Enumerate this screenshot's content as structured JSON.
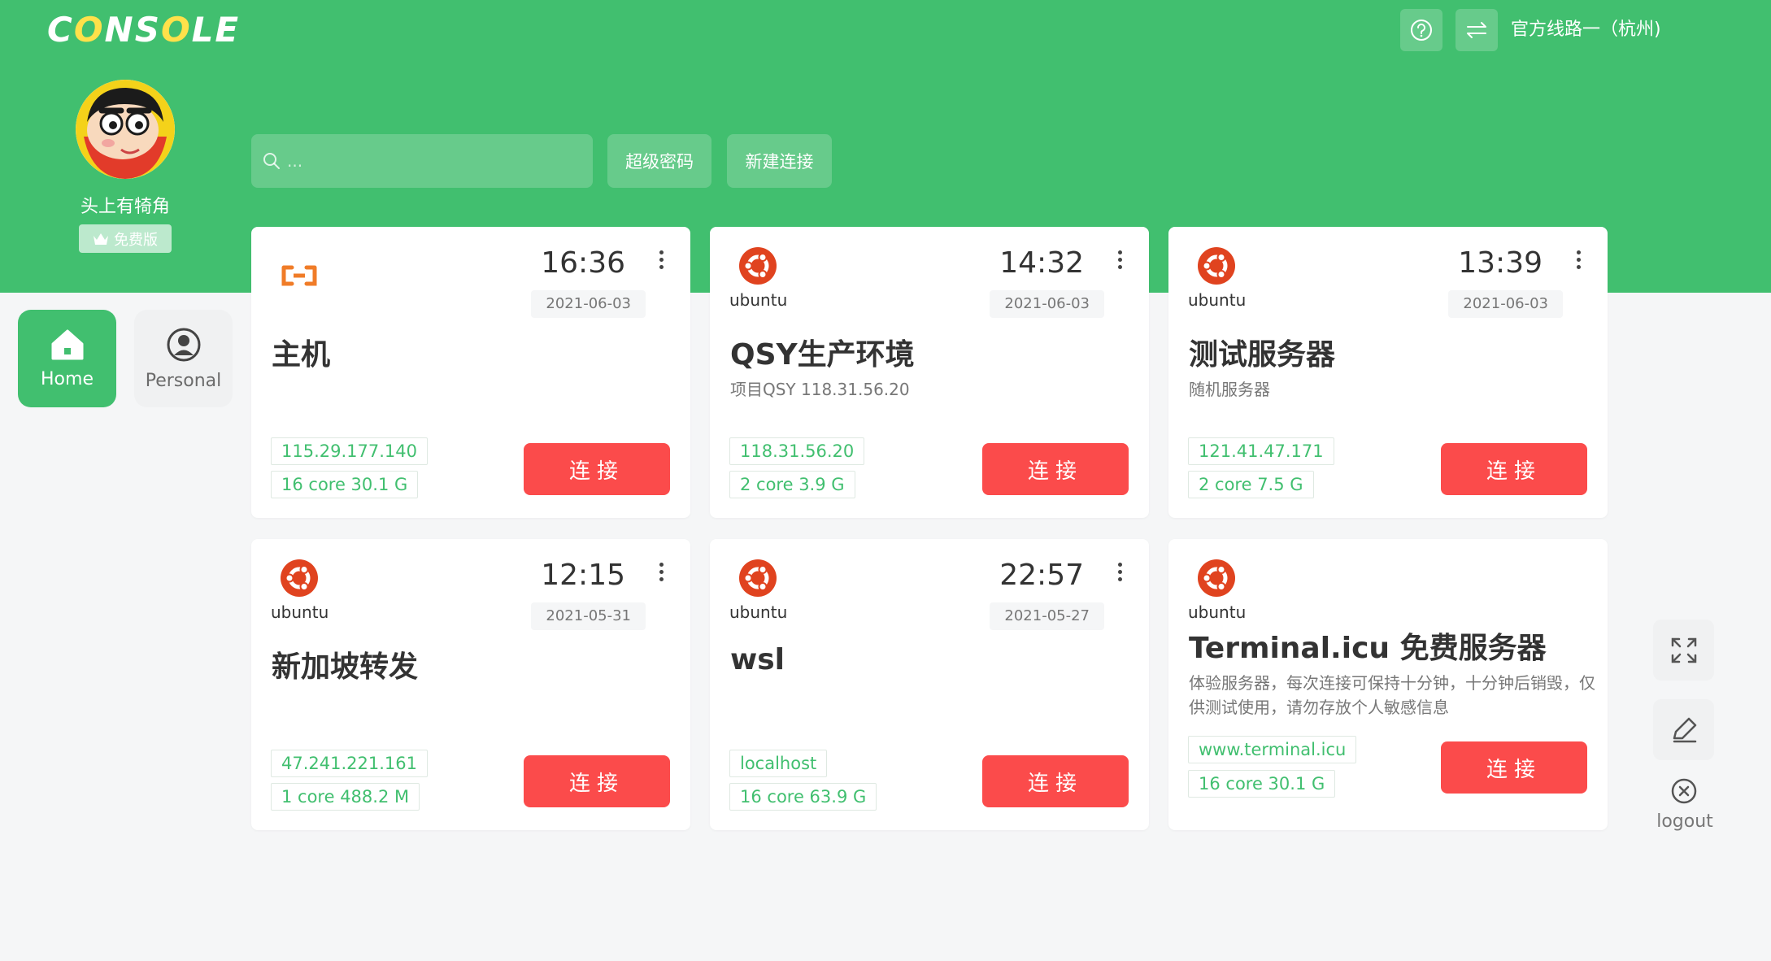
{
  "app": {
    "logo_text_pre": "C",
    "logo_text_o": "O",
    "logo_text_mid": "NS",
    "logo_text_o2": "O",
    "logo_text_post": "LE"
  },
  "topbar": {
    "route_label": "官方线路一（杭州)"
  },
  "user": {
    "name": "头上有犄角",
    "plan": "免费版"
  },
  "nav": {
    "home": "Home",
    "personal": "Personal"
  },
  "toolbar": {
    "search_placeholder": "...",
    "super_password": "超级密码",
    "new_connection": "新建连接"
  },
  "cards": [
    {
      "os": "aliyun",
      "time": "16:36",
      "date": "2021-06-03",
      "title": "主机",
      "subtitle": "",
      "ip": "115.29.177.140",
      "spec": "16 core 30.1 G",
      "connect": "连接"
    },
    {
      "os": "ubuntu",
      "os_label": "ubuntu",
      "time": "14:32",
      "date": "2021-06-03",
      "title": "QSY生产环境",
      "subtitle": "项目QSY 118.31.56.20",
      "ip": "118.31.56.20",
      "spec": "2 core 3.9 G",
      "connect": "连接"
    },
    {
      "os": "ubuntu",
      "os_label": "ubuntu",
      "time": "13:39",
      "date": "2021-06-03",
      "title": "测试服务器",
      "subtitle": "随机服务器",
      "ip": "121.41.47.171",
      "spec": "2 core 7.5 G",
      "connect": "连接"
    },
    {
      "os": "ubuntu",
      "os_label": "ubuntu",
      "time": "12:15",
      "date": "2021-05-31",
      "title": "新加坡转发",
      "subtitle": "",
      "ip": "47.241.221.161",
      "spec": "1 core 488.2 M",
      "connect": "连接"
    },
    {
      "os": "ubuntu",
      "os_label": "ubuntu",
      "time": "22:57",
      "date": "2021-05-27",
      "title": "wsl",
      "subtitle": "",
      "ip": "localhost",
      "spec": "16 core 63.9 G",
      "connect": "连接"
    },
    {
      "os": "ubuntu",
      "os_label": "ubuntu",
      "title": "Terminal.icu 免费服务器",
      "subtitle": "体验服务器，每次连接可保持十分钟，十分钟后销毁，仅供测试使用，请勿存放个人敏感信息",
      "ip": "www.terminal.icu",
      "spec": "16 core 30.1 G",
      "connect": "连接"
    }
  ],
  "tools": {
    "logout": "logout"
  },
  "colors": {
    "brand_green": "#41bf6f",
    "connect_red": "#fb4b4b",
    "ubuntu_orange": "#e0431f"
  }
}
